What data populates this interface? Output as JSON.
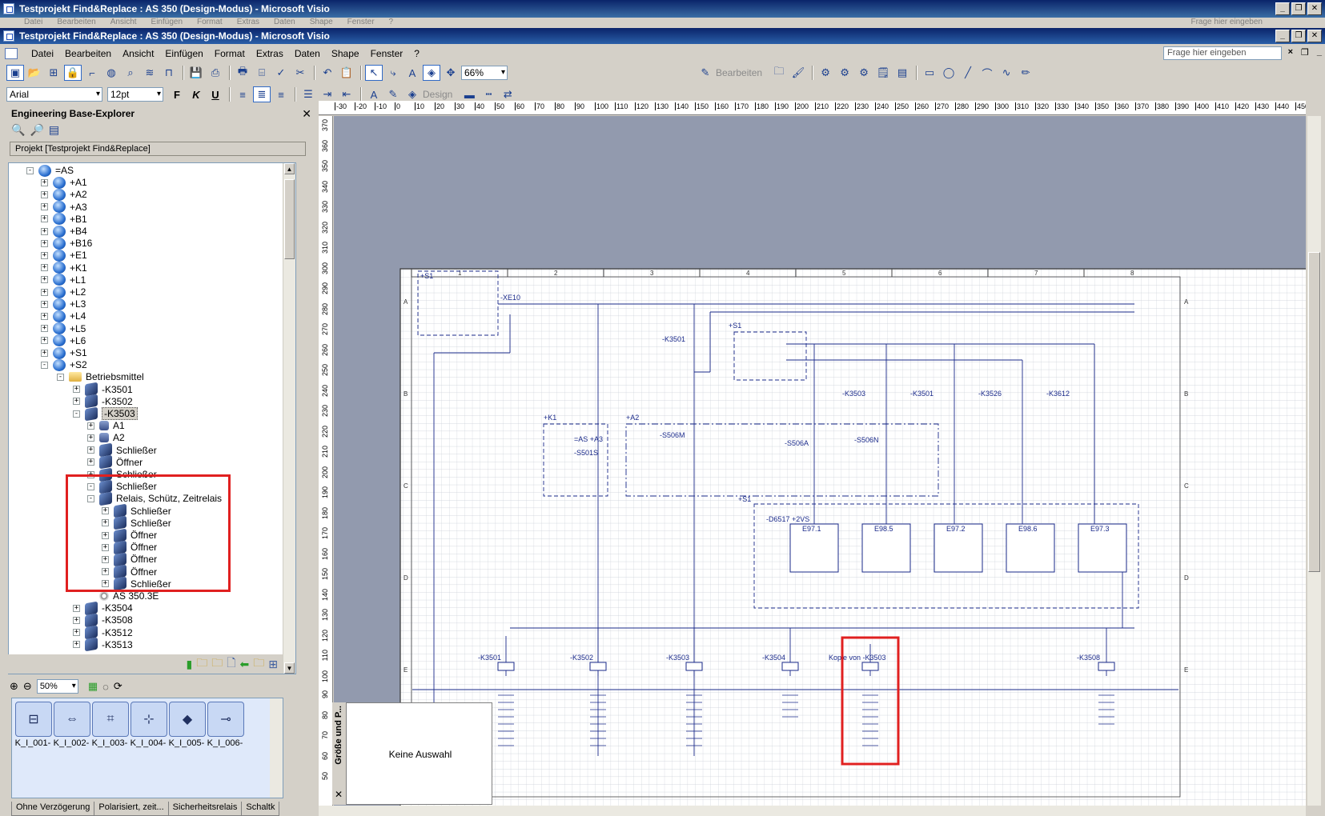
{
  "window": {
    "title": "Testprojekt Find&Replace : AS 350 (Design-Modus) - Microsoft Visio",
    "ghost_menu": [
      "Datei",
      "Bearbeiten",
      "Ansicht",
      "Einfügen",
      "Format",
      "Extras",
      "Daten",
      "Shape",
      "Fenster",
      "?"
    ],
    "ghost_askbox": "Frage hier eingeben"
  },
  "menu": [
    "Datei",
    "Bearbeiten",
    "Ansicht",
    "Einfügen",
    "Format",
    "Extras",
    "Daten",
    "Shape",
    "Fenster",
    "?"
  ],
  "askbox_placeholder": "Frage hier eingeben",
  "toolbar": {
    "zoom": "66%",
    "edit_label": "Bearbeiten",
    "font": "Arial",
    "font_size": "12pt",
    "bold": "F",
    "italic": "K",
    "underline": "U",
    "design_label": "Design"
  },
  "explorer": {
    "title": "Engineering Base-Explorer",
    "project": "Projekt [Testprojekt Find&Replace]",
    "tree": [
      {
        "label": "=AS",
        "level": 0,
        "exp": "-",
        "icon": "globe"
      },
      {
        "label": "+A1",
        "level": 1,
        "exp": "+",
        "icon": "globe"
      },
      {
        "label": "+A2",
        "level": 1,
        "exp": "+",
        "icon": "globe"
      },
      {
        "label": "+A3",
        "level": 1,
        "exp": "+",
        "icon": "globe"
      },
      {
        "label": "+B1",
        "level": 1,
        "exp": "+",
        "icon": "globe"
      },
      {
        "label": "+B4",
        "level": 1,
        "exp": "+",
        "icon": "globe"
      },
      {
        "label": "+B16",
        "level": 1,
        "exp": "+",
        "icon": "globe"
      },
      {
        "label": "+E1",
        "level": 1,
        "exp": "+",
        "icon": "globe"
      },
      {
        "label": "+K1",
        "level": 1,
        "exp": "+",
        "icon": "globe"
      },
      {
        "label": "+L1",
        "level": 1,
        "exp": "+",
        "icon": "globe"
      },
      {
        "label": "+L2",
        "level": 1,
        "exp": "+",
        "icon": "globe"
      },
      {
        "label": "+L3",
        "level": 1,
        "exp": "+",
        "icon": "globe"
      },
      {
        "label": "+L4",
        "level": 1,
        "exp": "+",
        "icon": "globe"
      },
      {
        "label": "+L5",
        "level": 1,
        "exp": "+",
        "icon": "globe"
      },
      {
        "label": "+L6",
        "level": 1,
        "exp": "+",
        "icon": "globe"
      },
      {
        "label": "+S1",
        "level": 1,
        "exp": "+",
        "icon": "globe"
      },
      {
        "label": "+S2",
        "level": 1,
        "exp": "-",
        "icon": "globe"
      },
      {
        "label": "Betriebsmittel",
        "level": 2,
        "exp": "-",
        "icon": "folder"
      },
      {
        "label": "-K3501",
        "level": 3,
        "exp": "+",
        "icon": "box"
      },
      {
        "label": "-K3502",
        "level": 3,
        "exp": "+",
        "icon": "box"
      },
      {
        "label": "-K3503",
        "level": 3,
        "exp": "-",
        "icon": "box",
        "selected": true
      },
      {
        "label": "A1",
        "level": 4,
        "exp": "+",
        "icon": "small"
      },
      {
        "label": "A2",
        "level": 4,
        "exp": "+",
        "icon": "small"
      },
      {
        "label": "Schließer",
        "level": 4,
        "exp": "+",
        "icon": "box"
      },
      {
        "label": "Öffner",
        "level": 4,
        "exp": "+",
        "icon": "box"
      },
      {
        "label": "Schließer",
        "level": 4,
        "exp": "+",
        "icon": "box"
      },
      {
        "label": "Schließer",
        "level": 4,
        "exp": "-",
        "icon": "box"
      },
      {
        "label": "Relais, Schütz, Zeitrelais",
        "level": 4,
        "exp": "-",
        "icon": "box"
      },
      {
        "label": "Schließer",
        "level": 5,
        "exp": "+",
        "icon": "box"
      },
      {
        "label": "Schließer",
        "level": 5,
        "exp": "+",
        "icon": "box"
      },
      {
        "label": "Öffner",
        "level": 5,
        "exp": "+",
        "icon": "box"
      },
      {
        "label": "Öffner",
        "level": 5,
        "exp": "+",
        "icon": "box"
      },
      {
        "label": "Öffner",
        "level": 5,
        "exp": "+",
        "icon": "box"
      },
      {
        "label": "Öffner",
        "level": 5,
        "exp": "+",
        "icon": "box"
      },
      {
        "label": "Schließer",
        "level": 5,
        "exp": "+",
        "icon": "box"
      },
      {
        "label": "AS 350.3E",
        "level": 4,
        "exp": "",
        "icon": "gear"
      },
      {
        "label": "-K3504",
        "level": 3,
        "exp": "+",
        "icon": "box"
      },
      {
        "label": "-K3508",
        "level": 3,
        "exp": "+",
        "icon": "box"
      },
      {
        "label": "-K3512",
        "level": 3,
        "exp": "+",
        "icon": "box"
      },
      {
        "label": "-K3513",
        "level": 3,
        "exp": "+",
        "icon": "box"
      }
    ]
  },
  "stencil": {
    "zoom": "50%",
    "items": [
      "K_I_001-",
      "K_I_002-",
      "K_I_003-",
      "K_I_004-",
      "K_I_005-",
      "K_I_006-"
    ],
    "tabs": [
      "Ohne Verzögerung",
      "Polarisiert, zeit...",
      "Sicherheitsrelais",
      "Schaltk"
    ]
  },
  "ruler_h": [
    "-30",
    "-20",
    "-10",
    "0",
    "10",
    "20",
    "30",
    "40",
    "50",
    "60",
    "70",
    "80",
    "90",
    "100",
    "110",
    "120",
    "130",
    "140",
    "150",
    "160",
    "170",
    "180",
    "190",
    "200",
    "210",
    "220",
    "230",
    "240",
    "250",
    "260",
    "270",
    "280",
    "290",
    "300",
    "310",
    "320",
    "330",
    "340",
    "350",
    "360",
    "370",
    "380",
    "390",
    "400",
    "410",
    "420",
    "430",
    "440",
    "450"
  ],
  "ruler_v": [
    "370",
    "360",
    "350",
    "340",
    "330",
    "320",
    "310",
    "300",
    "290",
    "280",
    "270",
    "260",
    "250",
    "240",
    "230",
    "220",
    "210",
    "200",
    "190",
    "180",
    "170",
    "160",
    "150",
    "140",
    "130",
    "120",
    "110",
    "100",
    "90",
    "80",
    "70",
    "60",
    "50"
  ],
  "size_panel": {
    "title": "Größe und P...",
    "empty_text": "Keine Auswahl"
  },
  "drawing": {
    "columns": [
      "1",
      "2",
      "3",
      "4",
      "5",
      "6",
      "7",
      "8"
    ],
    "rows": [
      "A",
      "B",
      "C",
      "D",
      "E"
    ],
    "labels": {
      "s1_top": "+S1",
      "xe10": "-XE10",
      "k3501_top": "-K3501",
      "s1_mid": "+S1",
      "d6517_box": "-D6517+2VS",
      "k3503": "-K3503",
      "k3501": "-K3501",
      "k3526": "-K3526",
      "k3612": "-K3612",
      "k1": "+K1",
      "a2": "+A2",
      "as_a3": "=AS +A3",
      "s501s": "-S501S",
      "s506m": "-S506M",
      "s506a": "-S506A",
      "s506n": "-S506N",
      "s1_low": "+S1",
      "d6517": "-D6517 +2VS",
      "e971": "E97.1",
      "e985": "E98.5",
      "e972": "E97.2",
      "e986": "E98.6",
      "e973": "E97.3",
      "bk3501": "-K3501",
      "bk3502": "-K3502",
      "bk3503": "-K3503",
      "bk3504": "-K3504",
      "kopie": "Kopie von -K3503",
      "bk3508": "-K3508"
    }
  },
  "colors": {
    "titlebar": "#0a246a",
    "canvas": "#929aae",
    "highlight": "#e02020",
    "ink": "#1a2a8a"
  }
}
